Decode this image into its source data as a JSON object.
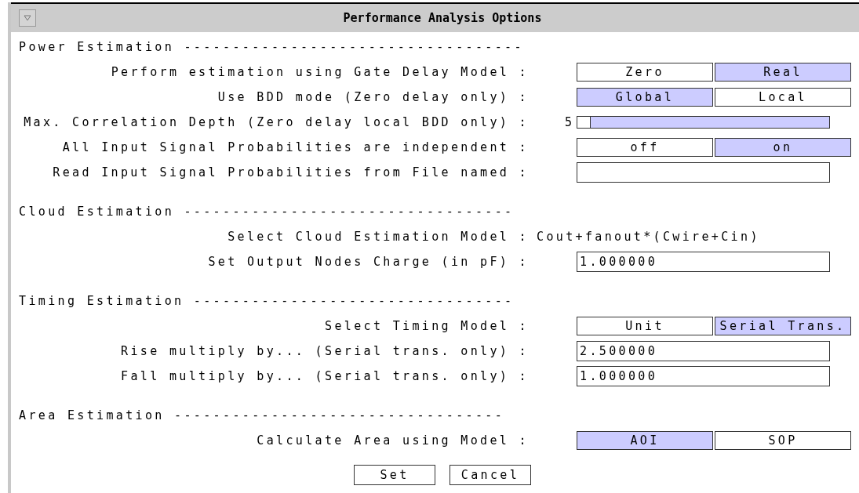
{
  "window": {
    "title": "Performance Analysis Options"
  },
  "sections": [
    {
      "title": "Power Estimation -----------------------------------",
      "rows": [
        {
          "kind": "toggle",
          "label": "Perform estimation using Gate Delay Model :",
          "options": [
            {
              "label": "Zero",
              "selected": false
            },
            {
              "label": "Real",
              "selected": true
            }
          ]
        },
        {
          "kind": "toggle",
          "label": "Use BDD mode (Zero delay only) :",
          "options": [
            {
              "label": "Global",
              "selected": true
            },
            {
              "label": "Local",
              "selected": false
            }
          ]
        },
        {
          "kind": "slider",
          "label": "Max. Correlation Depth (Zero delay local BDD only) :",
          "reading": "5",
          "level": 0
        },
        {
          "kind": "toggle",
          "label": "All Input Signal Probabilities are independent :",
          "options": [
            {
              "label": "off",
              "selected": false
            },
            {
              "label": "on",
              "selected": true
            }
          ]
        },
        {
          "kind": "field",
          "label": "Read Input Signal Probabilities from File named :"
        }
      ]
    },
    {
      "title": "Cloud Estimation ----------------------------------",
      "rows": [
        {
          "kind": "text",
          "label": "Select Cloud Estimation Model :",
          "value": "Cout+fanout*(Cwire+Cin)"
        },
        {
          "kind": "field",
          "label": "Set Output Nodes Charge (in pF) :",
          "value": "1.000000"
        }
      ]
    },
    {
      "title": "Timing Estimation ---------------------------------",
      "rows": [
        {
          "kind": "toggle",
          "label": "Select Timing Model :",
          "options": [
            {
              "label": "Unit",
              "selected": false
            },
            {
              "label": "Serial Trans.",
              "selected": true
            }
          ]
        },
        {
          "kind": "field",
          "label": "Rise multiply by... (Serial trans. only) :",
          "value": "2.500000"
        },
        {
          "kind": "field",
          "label": "Fall multiply by... (Serial trans. only) :",
          "value": "1.000000"
        }
      ]
    },
    {
      "title": "Area Estimation ----------------------------------",
      "rows": [
        {
          "kind": "toggle",
          "label": "Calculate Area using Model :",
          "options": [
            {
              "label": "AOI",
              "selected": true
            },
            {
              "label": "SOP",
              "selected": false
            }
          ]
        }
      ]
    }
  ],
  "buttons": [
    {
      "label": "Set"
    },
    {
      "label": "Cancel"
    }
  ]
}
